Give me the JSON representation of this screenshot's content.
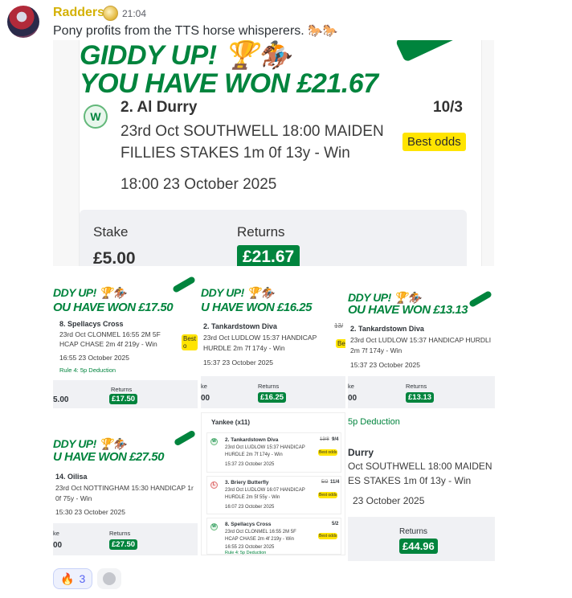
{
  "message": {
    "username": "Radders",
    "timestamp": "21:04",
    "text": "Pony profits from the TTS horse whisperers.",
    "emoji_text": "🐎🐎"
  },
  "main_card": {
    "header_partial": "GIDDY UP! 🏆🏇",
    "headline": "YOU HAVE WON £21.67",
    "badge": "W",
    "selection": "2. Al Durry",
    "odds": "10/3",
    "race_line1": "23rd Oct SOUTHWELL 18:00 MAIDEN",
    "race_line2": "FILLIES STAKES 1m 0f 13y - Win",
    "best_odds": "Best odds",
    "datetime": "18:00 23 October 2025",
    "stake_label": "Stake",
    "stake_value": "£5.00",
    "returns_label": "Returns",
    "returns_value": "£21.67"
  },
  "card_a": {
    "header": "DDY UP! 🏆🏇",
    "headline": "OU HAVE WON £17.50",
    "selection": "8. Spellacys Cross",
    "race_line1": "23rd Oct CLONMEL 16:55 2M 5F",
    "race_line2": "HCAP CHASE 2m 4f 219y - Win",
    "best_odds": "Best o",
    "datetime": "16:55 23 October 2025",
    "rule": "Rule 4: 5p Deduction",
    "stake_value": "5.00",
    "returns_label": "Returns",
    "returns_value": "£17.50"
  },
  "card_b": {
    "header": "DDY UP! 🏆🏇",
    "headline": "U HAVE WON £16.25",
    "selection": "2. Tankardstown Diva",
    "odds_struck": "13/",
    "race_line1": "23rd Oct LUDLOW 15:37 HANDICAP",
    "race_line2": "HURDLE 2m 7f 174y - Win",
    "best_odds": "Bes",
    "datetime": "15:37 23 October 2025",
    "stake_label": "ke",
    "stake_value": "00",
    "returns_label": "Returns",
    "returns_value": "£16.25"
  },
  "card_c": {
    "header": "DDY UP! 🏆🏇",
    "headline": "OU HAVE WON £13.13",
    "selection": "2. Tankardstown Diva",
    "race_line1": "23rd Oct LUDLOW 15:37 HANDICAP HURDLI",
    "race_line2": "2m 7f 174y - Win",
    "datetime": "15:37 23 October 2025",
    "stake_label": "ke",
    "stake_value": "00",
    "returns_label": "Returns",
    "returns_value": "£13.13"
  },
  "card_d": {
    "header": "DDY UP! 🏆🏇",
    "headline": "U HAVE WON £27.50",
    "selection": "14. Oilisa",
    "race_line1": "23rd Oct NOTTINGHAM 15:30 HANDICAP 1r",
    "race_line2": "0f 75y - Win",
    "datetime": "15:30 23 October 2025",
    "stake_label": "ke",
    "stake_value": "00",
    "returns_label": "Returns",
    "returns_value": "£27.50"
  },
  "card_e": {
    "title": "Yankee (x11)",
    "legs": [
      {
        "badge": "W",
        "selection": "2. Tankardstown Diva",
        "odds_struck": "13/8",
        "odds": "9/4",
        "race_line1": "23rd Oct LUDLOW 15:37 HANDICAP",
        "race_line2": "HURDLE 2m 7f 174y - Win",
        "datetime": "15:37 23 October 2025",
        "best_odds": "Best odds",
        "rule": ""
      },
      {
        "badge": "L",
        "selection": "3. Briery Butterfly",
        "odds_struck": "5/2",
        "odds": "11/4",
        "race_line1": "23rd Oct LUDLOW 16:07 HANDICAP",
        "race_line2": "HURDLE 2m 5f 55y - Win",
        "datetime": "16:07 23 October 2025",
        "best_odds": "Best odds",
        "rule": ""
      },
      {
        "badge": "W",
        "selection": "8. Spellacys Cross",
        "odds_struck": "",
        "odds": "5/2",
        "race_line1": "23rd Oct CLONMEL 16:55 2M 5F",
        "race_line2": "HCAP CHASE 2m 4f 219y - Win",
        "datetime": "16:55 23 October 2025",
        "best_odds": "Best odds",
        "rule": "Rule 4: 5p Deduction"
      }
    ]
  },
  "card_f": {
    "rule": "5p Deduction",
    "selection": "Durry",
    "race_line1": "Oct SOUTHWELL 18:00 MAIDEN",
    "race_line2": "ES STAKES 1m 0f 13y - Win",
    "datetime": "23 October 2025",
    "returns_label": "Returns",
    "returns_value": "£44.96"
  },
  "reactions": [
    {
      "icon": "fire-icon",
      "emoji": "🔥",
      "count": "3"
    }
  ],
  "colors": {
    "brand_green": "#00843d",
    "best_odds_yellow": "#ffe400",
    "username_gold": "#d4b106"
  }
}
